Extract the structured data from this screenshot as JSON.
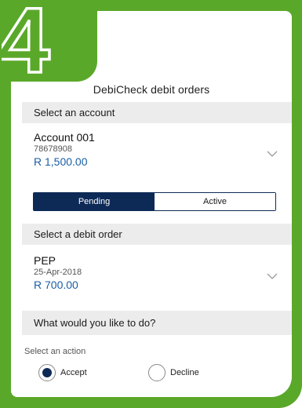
{
  "step": {
    "number": "4"
  },
  "screen": {
    "title": "DebiCheck debit orders"
  },
  "account_section": {
    "header": "Select an account",
    "name": "Account 001",
    "number": "78678908",
    "balance": "R 1,500.00"
  },
  "status_toggle": {
    "options": [
      "Pending",
      "Active"
    ],
    "selected": "Pending"
  },
  "debit_section": {
    "header": "Select a debit order",
    "name": "PEP",
    "date": "25-Apr-2018",
    "amount": "R 700.00"
  },
  "action_section": {
    "header": "What would you like to do?",
    "label": "Select an action",
    "options": [
      "Accept",
      "Decline"
    ],
    "selected": "Accept"
  },
  "colors": {
    "frame_green": "#5aa829",
    "navy": "#0d2a57",
    "amount_blue": "#1a5ea6",
    "section_grey": "#ececec"
  },
  "icons": [
    "plus-outline-icon",
    "chevron-down-icon",
    "radio-selected-icon",
    "radio-unselected-icon"
  ]
}
